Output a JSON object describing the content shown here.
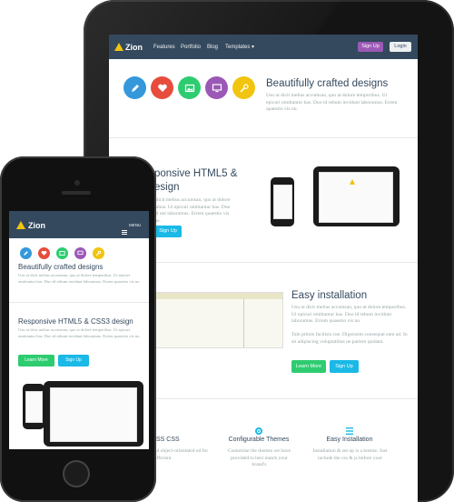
{
  "brand": {
    "name": "Zion",
    "accent": "#f1c40f",
    "nav_bg": "#34495e"
  },
  "tablet": {
    "nav": {
      "items": [
        "Features",
        "Portfolio",
        "Blog",
        "Templates ▾"
      ],
      "signup": "Sign Up",
      "login": "Login"
    },
    "hero": {
      "title": "Beautifully crafted designs",
      "text": "Usu ut dicit melius accumsan, quo at dolore temporibus. Ut epicuri omittantur has. Duo id rebum invidunt laboramus. Errem quaestio vis no."
    },
    "responsive": {
      "title_line1": "ponsive HTML5 &",
      "title_line2": "esign",
      "text": "tdicit melius accumsan, quo at dolore rabus. Ut epicuri omittantur has. Duo id unt laboramus. Errem quaestio vis no.",
      "button": "Sign Up"
    },
    "install": {
      "title": "Easy installation",
      "text1": "Usu ut dicit melius accumsan, quo at dolore temporibus. Ut epicuri omittantur has. Duo id rebum invidunt laboramus. Errem quaestio vis no.",
      "text2": "Tale primis facilisis cue. Dignissim consequat eam ad. In sit adipiscing voluptatibus ne pariem quidam.",
      "learn_more": "Learn More",
      "signup": "Sign Up"
    },
    "features": [
      {
        "title": "SS CSS",
        "text": "ed object-orientated ed for efficient"
      },
      {
        "title": "Configurable Themes",
        "text": "Customise the themes we have provided to best match your brand's"
      },
      {
        "title": "Easy Installation",
        "text": "Installation & set up is a breeze. Just include the css & js before your"
      }
    ]
  },
  "phone": {
    "nav": {
      "menu": "MENU"
    },
    "hero": {
      "title": "Beautifully crafted designs",
      "text": "Usu ut dicit melius accumsan, quo at dolore temporibus. Ut epicuri omittantur has. Duo id rebum invidunt laboramus. Errem quaestio vis no."
    },
    "responsive": {
      "title": "Responsive HTML5 & CSS3 design",
      "text": "Usu ut dicit melius accumsan, quo at dolore temporibus. Ut epicuri omittantur has. Duo id rebum invidunt laboramus. Errem quaestio vis no.",
      "learn_more": "Learn More",
      "signup": "Sign Up"
    }
  },
  "icon_colors": [
    "#3498db",
    "#e74c3c",
    "#2ecc71",
    "#9b59b6",
    "#f1c40f"
  ]
}
